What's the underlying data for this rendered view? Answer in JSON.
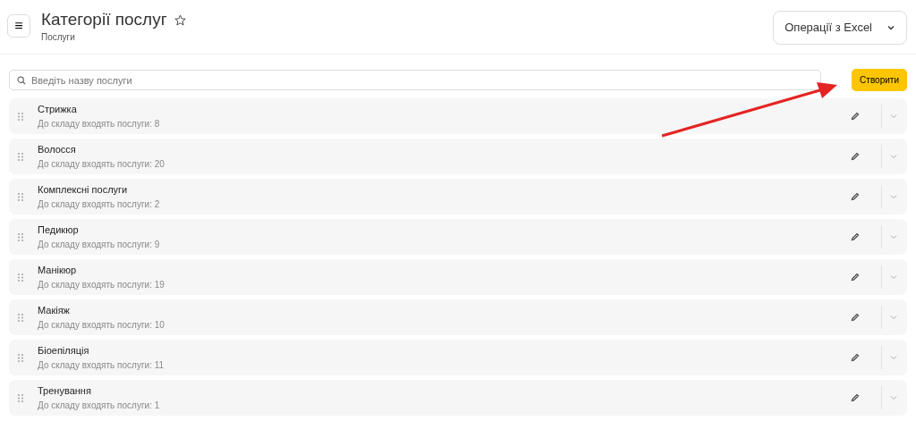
{
  "header": {
    "menu_button": "≡",
    "title": "Категорії послуг",
    "subtitle": "Послуги",
    "excel_button": "Операції з Excel"
  },
  "search": {
    "placeholder": "Введіть назву послуги"
  },
  "create_button": "Створити",
  "categories": [
    {
      "name": "Стрижка",
      "count_text": "До складу входять послуги: 8"
    },
    {
      "name": "Волосся",
      "count_text": "До складу входять послуги: 20"
    },
    {
      "name": "Комплексні послуги",
      "count_text": "До складу входять послуги: 2"
    },
    {
      "name": "Педикюр",
      "count_text": "До складу входять послуги: 9"
    },
    {
      "name": "Манікюр",
      "count_text": "До складу входять послуги: 19"
    },
    {
      "name": "Макіяж",
      "count_text": "До складу входять послуги: 10"
    },
    {
      "name": "Біоепіляція",
      "count_text": "До складу входять послуги: 11"
    },
    {
      "name": "Тренування",
      "count_text": "До складу входять послуги: 1"
    }
  ]
}
